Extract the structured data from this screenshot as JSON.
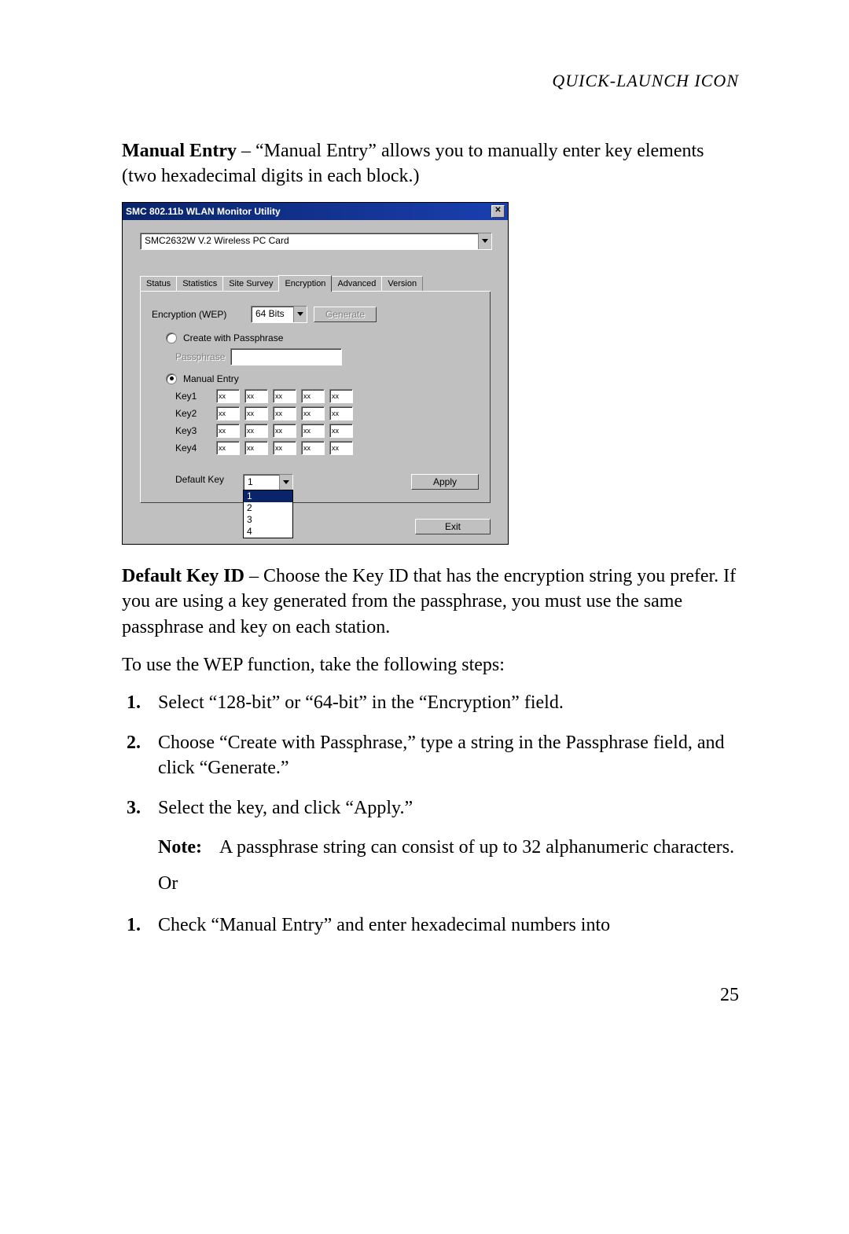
{
  "header": "QUICK-LAUNCH ICON",
  "manualEntry": {
    "title": "Manual Entry",
    "desc": " – “Manual Entry” allows you to manually enter key elements (two hexadecimal digits in each block.)"
  },
  "win": {
    "title": "SMC 802.11b WLAN Monitor Utility",
    "card": "SMC2632W V.2 Wireless PC Card",
    "tabs": [
      "Status",
      "Statistics",
      "Site Survey",
      "Encryption",
      "Advanced",
      "Version"
    ],
    "encLabel": "Encryption (WEP)",
    "bits": "64 Bits",
    "generate": "Generate",
    "createPass": "Create with Passphrase",
    "passLabel": "Passphrase",
    "manual": "Manual Entry",
    "keys": [
      "Key1",
      "Key2",
      "Key3",
      "Key4"
    ],
    "hex": "xx",
    "defaultKeyLabel": "Default Key",
    "defaultKeyValue": "1",
    "dropOptions": [
      "1",
      "2",
      "3",
      "4"
    ],
    "apply": "Apply",
    "exit": "Exit"
  },
  "defaultKeyID": {
    "title": "Default Key ID",
    "desc": " – Choose the Key ID that has the encryption string you prefer. If you are using a key generated from the passphrase, you must use the same passphrase and key on each station."
  },
  "wepIntro": "To use the WEP function, take the following steps:",
  "steps": [
    "Select “128-bit” or “64-bit” in the “Encryption” field.",
    "Choose “Create with Passphrase,” type a string in the Passphrase field, and click “Generate.”",
    "Select the key, and click “Apply.”"
  ],
  "note": {
    "label": "Note:",
    "text": "A passphrase string can consist of up to 32 alphanumeric characters."
  },
  "or": "Or",
  "steps2": [
    "Check “Manual Entry” and enter hexadecimal numbers into"
  ],
  "pageNum": "25"
}
